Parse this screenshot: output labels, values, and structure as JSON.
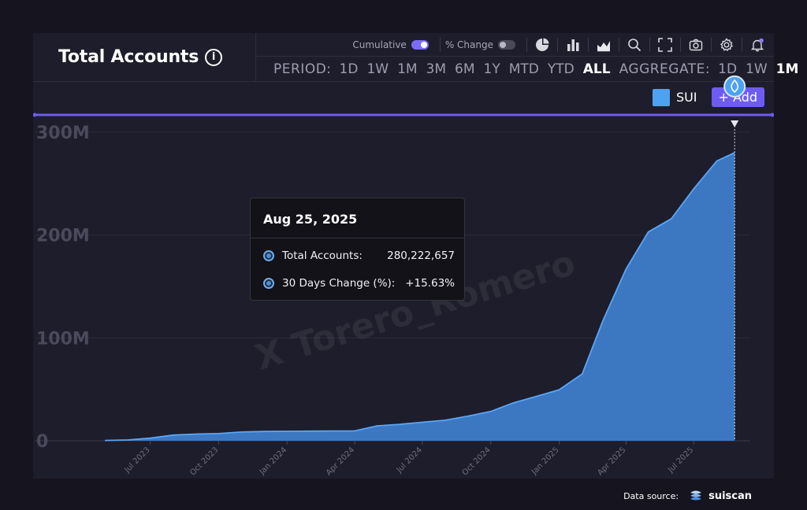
{
  "header": {
    "title": "Total Accounts",
    "info_icon": "info-icon"
  },
  "toolbar": {
    "cumulative_label": "Cumulative",
    "cumulative_on": true,
    "pct_change_label": "% Change",
    "pct_change_on": false,
    "icons": [
      "pie-chart-icon",
      "bar-chart-icon",
      "area-chart-icon",
      "zoom-icon",
      "fullscreen-icon",
      "camera-icon",
      "settings-icon",
      "notification-bell-icon"
    ],
    "accent": "#7b6cf6"
  },
  "period": {
    "label": "PERIOD:",
    "options": [
      "1D",
      "1W",
      "1M",
      "3M",
      "6M",
      "1Y",
      "MTD",
      "YTD",
      "ALL"
    ],
    "active": "ALL"
  },
  "aggregate": {
    "label": "AGGREGATE:",
    "options": [
      "1D",
      "1W",
      "1M"
    ],
    "active": "1M"
  },
  "series_legend": {
    "name": "SUI",
    "color": "#4da2f2",
    "add_label": "+ Add"
  },
  "tooltip": {
    "date": "Aug 25, 2025",
    "rows": [
      {
        "label": "Total Accounts:",
        "value": "280,222,657"
      },
      {
        "label": "30 Days Change (%):",
        "value": "+15.63%"
      }
    ]
  },
  "watermark": "X Torero_Romero",
  "footer": {
    "label": "Data source:",
    "source": "suiscan"
  },
  "chart_data": {
    "type": "area",
    "series": [
      {
        "name": "SUI",
        "color": "#4a8fe0",
        "points": [
          [
            "2023-05-01",
            0.3
          ],
          [
            "2023-06-01",
            0.8
          ],
          [
            "2023-07-01",
            2.5
          ],
          [
            "2023-08-01",
            5.5
          ],
          [
            "2023-09-01",
            6.5
          ],
          [
            "2023-10-01",
            7.0
          ],
          [
            "2023-11-01",
            8.5
          ],
          [
            "2023-12-01",
            9.0
          ],
          [
            "2024-01-01",
            9.2
          ],
          [
            "2024-02-01",
            9.3
          ],
          [
            "2024-03-01",
            9.5
          ],
          [
            "2024-04-01",
            9.6
          ],
          [
            "2024-05-01",
            14.5
          ],
          [
            "2024-06-01",
            16.0
          ],
          [
            "2024-07-01",
            18.0
          ],
          [
            "2024-08-01",
            20.0
          ],
          [
            "2024-09-01",
            24.0
          ],
          [
            "2024-10-01",
            28.5
          ],
          [
            "2024-11-01",
            37.0
          ],
          [
            "2024-12-01",
            43.0
          ],
          [
            "2025-01-01",
            49.5
          ],
          [
            "2025-02-01",
            65.0
          ],
          [
            "2025-03-01",
            117.0
          ],
          [
            "2025-04-01",
            167.0
          ],
          [
            "2025-05-01",
            203.0
          ],
          [
            "2025-06-01",
            216.0
          ],
          [
            "2025-07-01",
            245.0
          ],
          [
            "2025-08-01",
            272.0
          ],
          [
            "2025-08-25",
            280.2
          ]
        ]
      }
    ],
    "y_unit": "M",
    "y_ticks": [
      "0",
      "100M",
      "200M",
      "300M"
    ],
    "y_tick_values": [
      0,
      100,
      200,
      300
    ],
    "ylim": [
      0,
      300
    ],
    "xlim": [
      "2023-04-15",
      "2025-09-15"
    ],
    "x_ticks": [
      {
        "date": "2023-07-01",
        "label": "Jul 2023"
      },
      {
        "date": "2023-10-01",
        "label": "Oct 2023"
      },
      {
        "date": "2024-01-01",
        "label": "Jan 2024"
      },
      {
        "date": "2024-04-01",
        "label": "Apr 2024"
      },
      {
        "date": "2024-07-01",
        "label": "Jul 2024"
      },
      {
        "date": "2024-10-01",
        "label": "Oct 2024"
      },
      {
        "date": "2025-01-01",
        "label": "Jan 2025"
      },
      {
        "date": "2025-04-01",
        "label": "Apr 2025"
      },
      {
        "date": "2025-07-01",
        "label": "Jul 2025"
      }
    ],
    "highlight": {
      "date": "2025-08-25",
      "value": 280.2
    },
    "grid": true
  }
}
